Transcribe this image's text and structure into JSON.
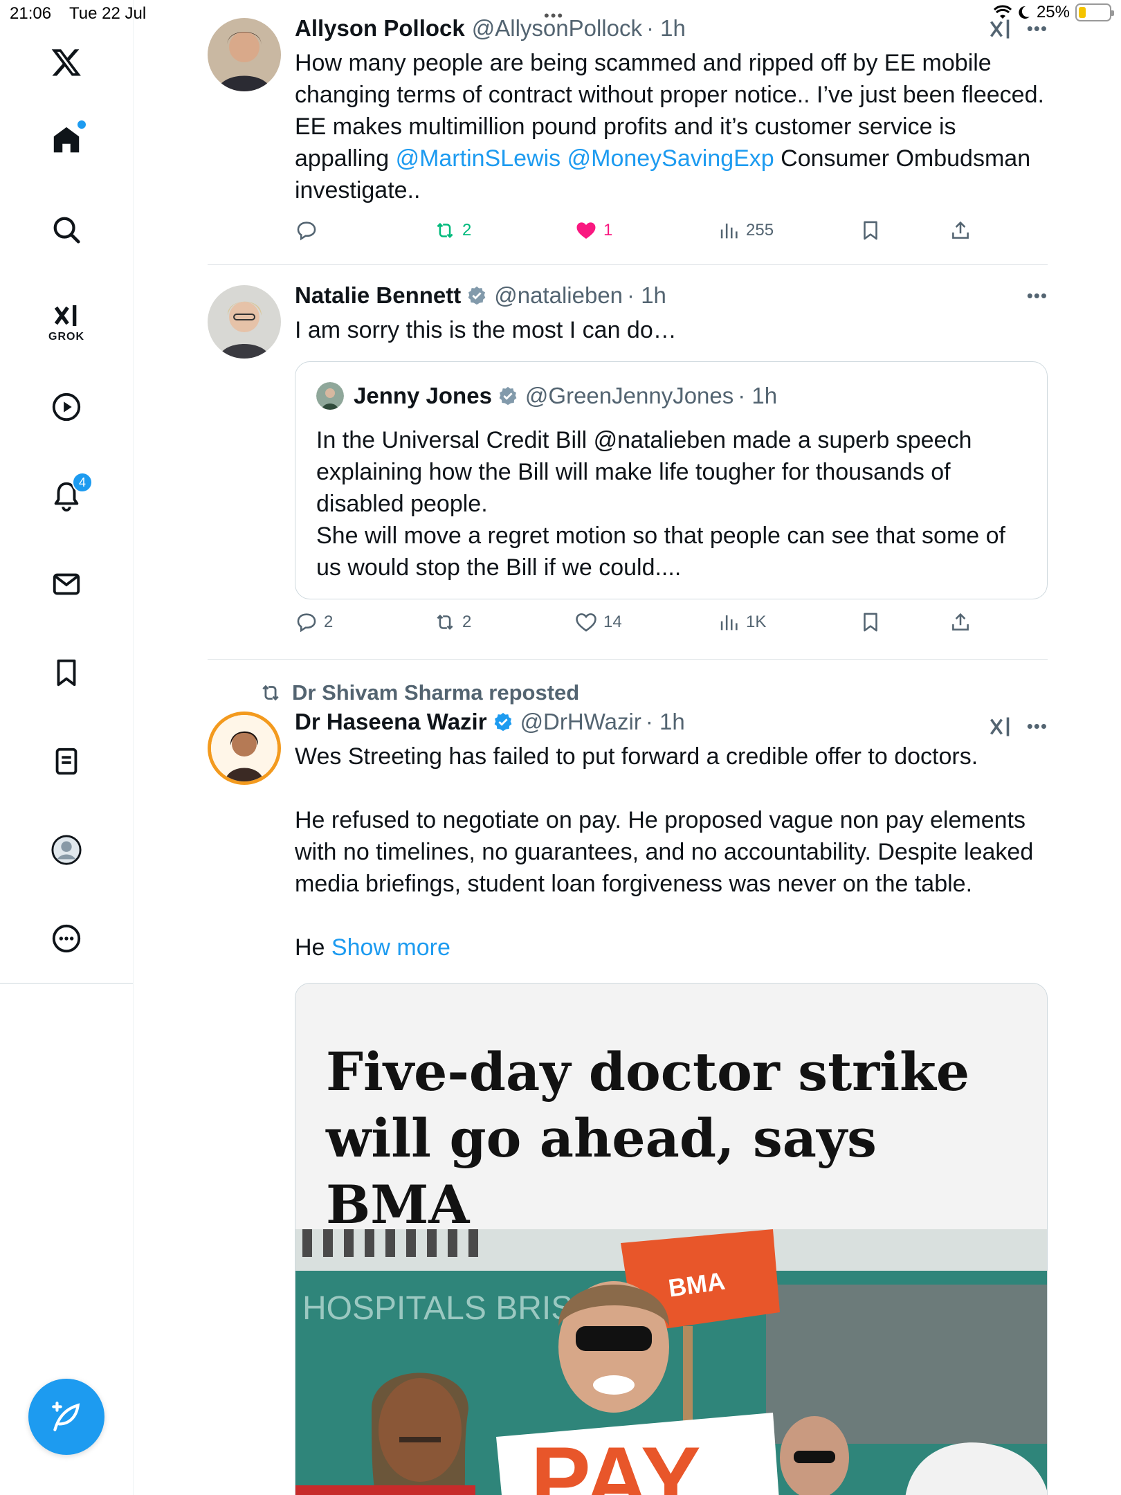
{
  "status_bar": {
    "time": "21:06",
    "date": "Tue 22 Jul",
    "battery": "25%"
  },
  "nav": {
    "notifications_badge": "4",
    "grok_label": "GROK"
  },
  "tweets": [
    {
      "name": "Allyson Pollock",
      "handle": "@AllysonPollock",
      "time": "· 1h",
      "body_part1": "How many people are  being  scammed and ripped off by EE mobile changing terms of contract without proper notice.. I’ve just been fleeced.  EE makes multimillion pound profits and it’s customer service is appalling ",
      "mention1": "@MartinSLewis",
      "mention2": "@MoneySavingExp",
      "body_part2": " Consumer Ombudsman  investigate..",
      "reposts": "2",
      "likes": "1",
      "views": "255"
    },
    {
      "name": "Natalie Bennett",
      "handle": "@natalieben",
      "time": "· 1h",
      "body": "I am sorry this is the most I can do…",
      "quote": {
        "name": "Jenny Jones",
        "handle": "@GreenJennyJones",
        "time": "· 1h",
        "body_line1": "In the Universal Credit Bill @natalieben made a superb speech explaining how the Bill will make life tougher for thousands of disabled people.",
        "body_line2": "She will move a regret motion so that people can see that some of us would stop the Bill if we could...."
      },
      "replies": "2",
      "reposts": "2",
      "likes": "14",
      "views": "1K"
    },
    {
      "repost_label": "Dr Shivam Sharma reposted",
      "name": "Dr Haseena Wazir",
      "handle": "@DrHWazir",
      "time": "· 1h",
      "para1": "Wes Streeting has failed to put forward a credible offer to doctors.",
      "para2": "He refused to negotiate on pay. He proposed vague non pay elements with no timelines, no guarantees, and no accountability. Despite leaked media briefings, student loan forgiveness was never on the table.",
      "para3_start": "He ",
      "show_more": "Show more",
      "article_title": "Five-day doctor strike will go ahead, says BMA",
      "photo_sign_bma": "BMA",
      "photo_sign_pay": "PAY",
      "photo_building": "HOSPITALS BRIST"
    }
  ],
  "colors": {
    "accent": "#1d9bf0",
    "like": "#f91880",
    "repost": "#00ba7c",
    "secondary_text": "#536471"
  }
}
